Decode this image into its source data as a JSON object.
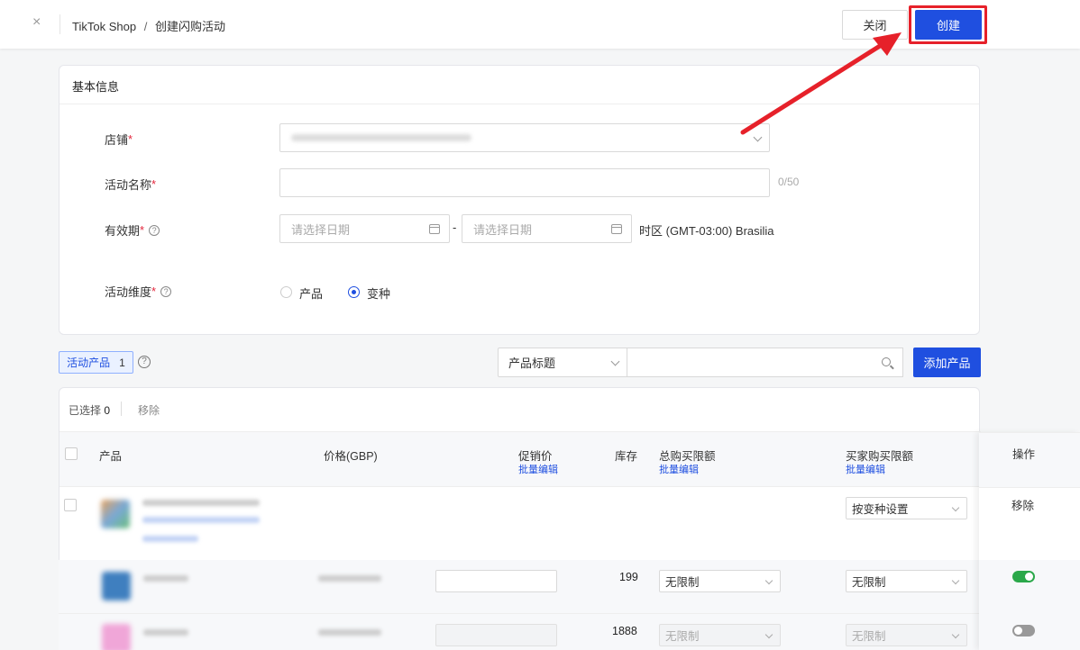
{
  "header": {
    "close_icon": "×",
    "breadcrumb_root": "TikTok Shop",
    "breadcrumb_sep": "/",
    "breadcrumb_current": "创建闪购活动",
    "close_button": "关闭",
    "create_button": "创建"
  },
  "basic": {
    "title": "基本信息",
    "store_label": "店铺",
    "name_label": "活动名称",
    "name_counter": "0/50",
    "validity_label": "有效期",
    "date_start_placeholder": "请选择日期",
    "date_end_placeholder": "请选择日期",
    "date_sep": "-",
    "timezone": "时区 (GMT-03:00) Brasilia",
    "dimension_label": "活动维度",
    "dimension_options": [
      "产品",
      "变种"
    ],
    "dimension_selected": "变种",
    "required_mark": "*",
    "help_mark": "?"
  },
  "toolbar": {
    "active_tab": "活动产品",
    "active_count": "1",
    "help_mark": "?",
    "filter_select": "产品标题",
    "add_button": "添加产品"
  },
  "table": {
    "selected_label": "已选择",
    "selected_count": "0",
    "remove_label": "移除",
    "headers": {
      "product": "产品",
      "price": "价格(GBP)",
      "promo_price": "促销价",
      "stock": "库存",
      "total_limit": "总购买限额",
      "buyer_limit": "买家购买限额",
      "ops": "操作",
      "bulk_edit": "批量编辑"
    },
    "product_row": {
      "buyer_limit_select": "按变种设置",
      "ops_remove": "移除"
    },
    "variants": [
      {
        "stock": "199",
        "total_limit": "无限制",
        "buyer_limit": "无限制",
        "enabled": true
      },
      {
        "stock": "1888",
        "total_limit": "无限制",
        "buyer_limit": "无限制",
        "enabled": false
      }
    ]
  },
  "colors": {
    "primary": "#1f4fe0",
    "highlight": "#e6212a",
    "toggle_on": "#2ba84a"
  }
}
